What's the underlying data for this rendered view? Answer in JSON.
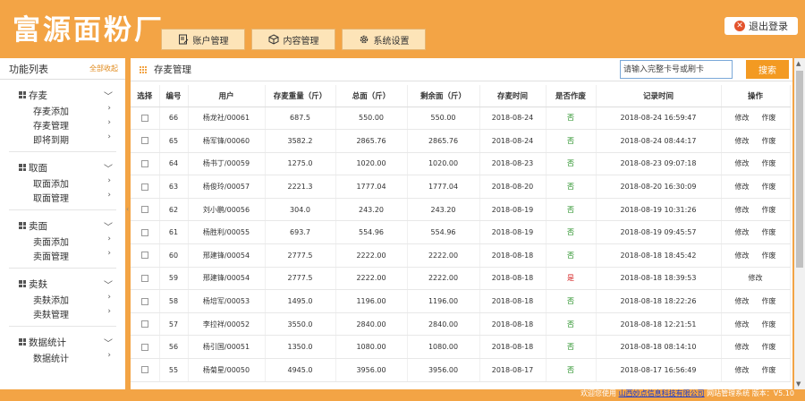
{
  "header": {
    "logo": "富源面粉厂",
    "nav": [
      {
        "label": "账户管理",
        "icon": "document-edit-icon"
      },
      {
        "label": "内容管理",
        "icon": "cube-icon"
      },
      {
        "label": "系统设置",
        "icon": "gear-icon"
      }
    ],
    "logout": "退出登录"
  },
  "sidebar": {
    "title": "功能列表",
    "collapse_all": "全部收起",
    "groups": [
      {
        "label": "存麦",
        "items": [
          "存麦添加",
          "存麦管理",
          "即将到期"
        ]
      },
      {
        "label": "取面",
        "items": [
          "取面添加",
          "取面管理"
        ]
      },
      {
        "label": "卖面",
        "items": [
          "卖面添加",
          "卖面管理"
        ]
      },
      {
        "label": "卖麸",
        "items": [
          "卖麸添加",
          "卖麸管理"
        ]
      },
      {
        "label": "数据统计",
        "items": [
          "数据统计"
        ]
      }
    ]
  },
  "main": {
    "title": "存麦管理",
    "search_placeholder": "请输入完整卡号或刷卡",
    "search_button": "搜索",
    "columns": [
      "选择",
      "编号",
      "用户",
      "存麦重量（斤）",
      "总面（斤）",
      "剩余面（斤）",
      "存麦时间",
      "是否作废",
      "记录时间",
      "操作"
    ],
    "rows": [
      {
        "id": "66",
        "user": "杨龙社/00061",
        "weight": "687.5",
        "total": "550.00",
        "remain": "550.00",
        "date": "2018-08-24",
        "void": "否",
        "rec": "2018-08-24 16:59:47",
        "ops": [
          "修改",
          "作废"
        ]
      },
      {
        "id": "65",
        "user": "杨军锋/00060",
        "weight": "3582.2",
        "total": "2865.76",
        "remain": "2865.76",
        "date": "2018-08-24",
        "void": "否",
        "rec": "2018-08-24 08:44:17",
        "ops": [
          "修改",
          "作废"
        ]
      },
      {
        "id": "64",
        "user": "杨书丁/00059",
        "weight": "1275.0",
        "total": "1020.00",
        "remain": "1020.00",
        "date": "2018-08-23",
        "void": "否",
        "rec": "2018-08-23 09:07:18",
        "ops": [
          "修改",
          "作废"
        ]
      },
      {
        "id": "63",
        "user": "杨俊玲/00057",
        "weight": "2221.3",
        "total": "1777.04",
        "remain": "1777.04",
        "date": "2018-08-20",
        "void": "否",
        "rec": "2018-08-20 16:30:09",
        "ops": [
          "修改",
          "作废"
        ]
      },
      {
        "id": "62",
        "user": "刘小鹏/00056",
        "weight": "304.0",
        "total": "243.20",
        "remain": "243.20",
        "date": "2018-08-19",
        "void": "否",
        "rec": "2018-08-19 10:31:26",
        "ops": [
          "修改",
          "作废"
        ]
      },
      {
        "id": "61",
        "user": "杨胜利/00055",
        "weight": "693.7",
        "total": "554.96",
        "remain": "554.96",
        "date": "2018-08-19",
        "void": "否",
        "rec": "2018-08-19 09:45:57",
        "ops": [
          "修改",
          "作废"
        ]
      },
      {
        "id": "60",
        "user": "邢建锋/00054",
        "weight": "2777.5",
        "total": "2222.00",
        "remain": "2222.00",
        "date": "2018-08-18",
        "void": "否",
        "rec": "2018-08-18 18:45:42",
        "ops": [
          "修改",
          "作废"
        ]
      },
      {
        "id": "59",
        "user": "邢建锋/00054",
        "weight": "2777.5",
        "total": "2222.00",
        "remain": "2222.00",
        "date": "2018-08-18",
        "void": "是",
        "rec": "2018-08-18 18:39:53",
        "ops": [
          "修改"
        ]
      },
      {
        "id": "58",
        "user": "杨培军/00053",
        "weight": "1495.0",
        "total": "1196.00",
        "remain": "1196.00",
        "date": "2018-08-18",
        "void": "否",
        "rec": "2018-08-18 18:22:26",
        "ops": [
          "修改",
          "作废"
        ]
      },
      {
        "id": "57",
        "user": "李拉祥/00052",
        "weight": "3550.0",
        "total": "2840.00",
        "remain": "2840.00",
        "date": "2018-08-18",
        "void": "否",
        "rec": "2018-08-18 12:21:51",
        "ops": [
          "修改",
          "作废"
        ]
      },
      {
        "id": "56",
        "user": "杨引国/00051",
        "weight": "1350.0",
        "total": "1080.00",
        "remain": "1080.00",
        "date": "2018-08-18",
        "void": "否",
        "rec": "2018-08-18 08:14:10",
        "ops": [
          "修改",
          "作废"
        ]
      },
      {
        "id": "55",
        "user": "杨菊星/00050",
        "weight": "4945.0",
        "total": "3956.00",
        "remain": "3956.00",
        "date": "2018-08-17",
        "void": "否",
        "rec": "2018-08-17 16:56:49",
        "ops": [
          "修改",
          "作废"
        ]
      }
    ]
  },
  "footer": {
    "welcome": "欢迎您使用",
    "company": "山西妙点信息科技有限公司",
    "suffix": "网站管理系统",
    "version": "版本：V5.10"
  },
  "colors": {
    "accent": "#f3a445",
    "yes": "#d42020",
    "no": "#1a8a1a",
    "button": "#f39a22"
  }
}
